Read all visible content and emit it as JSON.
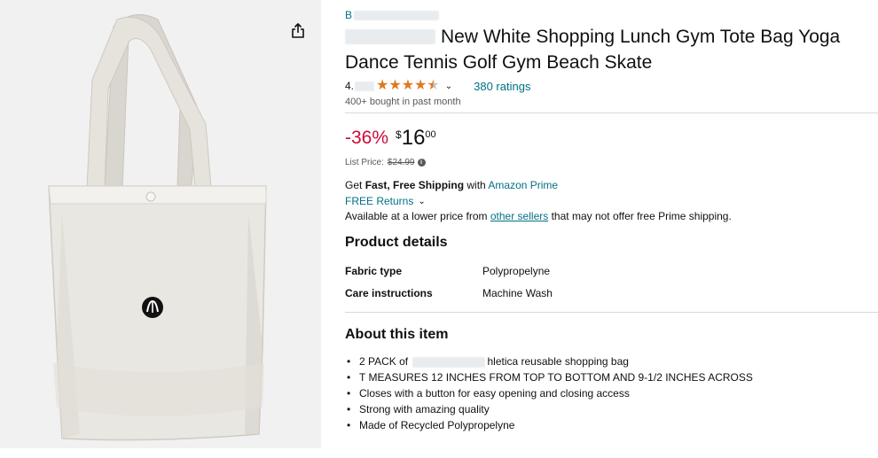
{
  "product": {
    "brand_visible": "B",
    "title_visible": "New White Shopping Lunch Gym Tote Bag Yoga Dance Tennis Golf Gym Beach Skate",
    "rating_prefix": "4.",
    "ratings_count": "380 ratings",
    "bought": "400+ bought in past month",
    "discount": "-36%",
    "price_symbol": "$",
    "price_whole": "16",
    "price_fraction": "00",
    "list_price_label": "List Price:",
    "list_price": "$24.99",
    "shipping_prefix": "Get",
    "shipping_bold": "Fast, Free Shipping",
    "shipping_with": "with",
    "shipping_link": "Amazon Prime",
    "returns": "FREE Returns",
    "lower_price_prefix": "Available at a lower price from",
    "lower_price_link": "other sellers",
    "lower_price_suffix": "that may not offer free Prime shipping."
  },
  "details": {
    "title": "Product details",
    "specs": [
      {
        "key": "Fabric type",
        "value": "Polypropelyne"
      },
      {
        "key": "Care instructions",
        "value": "Machine Wash"
      }
    ]
  },
  "about": {
    "title": "About this item",
    "bullets": [
      {
        "prefix": "2 PACK of",
        "suffix": "hletica reusable shopping bag"
      },
      {
        "text": "T MEASURES 12 INCHES FROM TOP TO BOTTOM AND 9-1/2 INCHES ACROSS"
      },
      {
        "text": "Closes with a button for easy opening and closing access"
      },
      {
        "text": "Strong with amazing quality"
      },
      {
        "text": "Made of Recycled Polypropelyne"
      }
    ]
  },
  "icons": {
    "share": "share-icon",
    "chevron": "chevron-down-icon",
    "info": "info-icon",
    "star": "star-icon"
  },
  "colors": {
    "link": "#007185",
    "discount": "#cc0c39",
    "star": "#de7921",
    "text": "#0f1111"
  }
}
